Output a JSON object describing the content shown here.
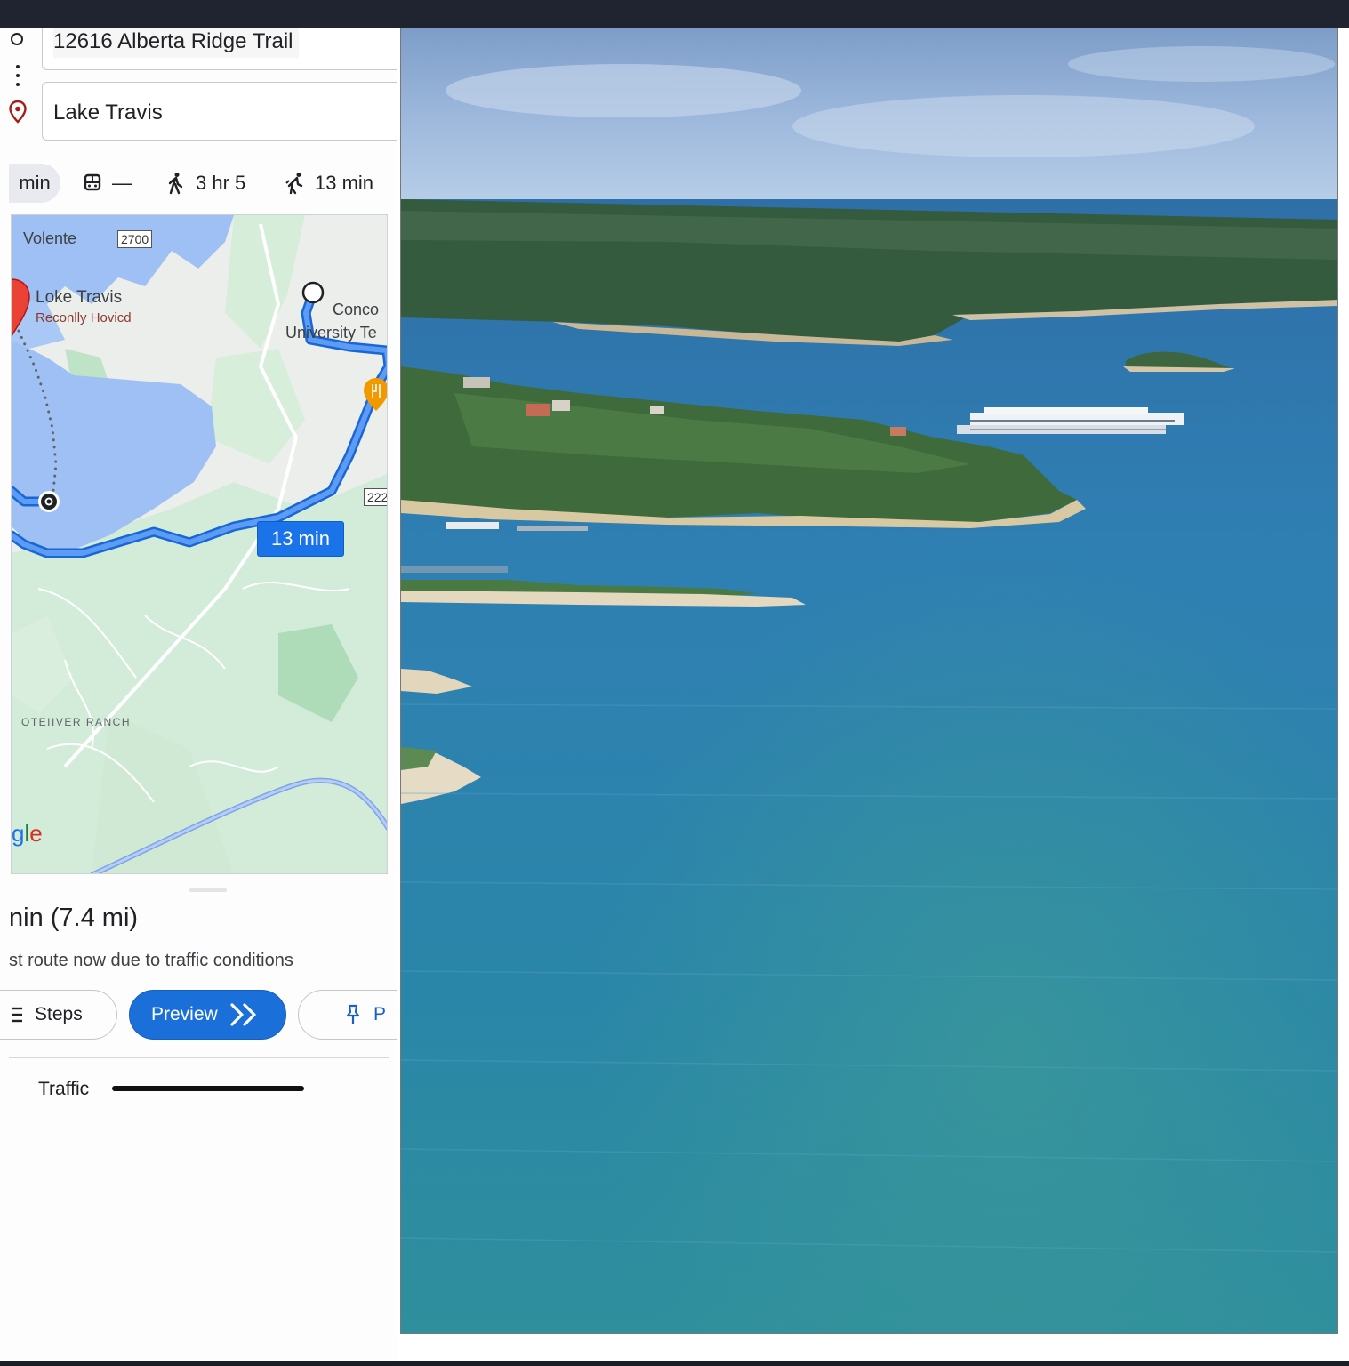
{
  "directions": {
    "origin_value": "12616 Alberta Ridge Trail",
    "destination_value": "Lake Travis"
  },
  "travel_modes": {
    "drive": "min",
    "transit": "—",
    "walk": "3 hr 5",
    "bike": "13 min"
  },
  "map": {
    "places": {
      "volente": "Volente",
      "lake_travis": "Loke Travis",
      "recently_viewed": "Reconlly Hovicd",
      "concordia": "Conco",
      "university": "University Te",
      "ranch": "OTEIIVER RANCH"
    },
    "route_badge": "13 min",
    "shields": {
      "a": "2700",
      "b": "222"
    },
    "logo": {
      "part1": "g",
      "part2": "l",
      "part3": "e"
    }
  },
  "route": {
    "duration": "nin (7.4 mi)",
    "note": "st route now due to traffic conditions"
  },
  "actions": {
    "steps": "Steps",
    "preview": "Preview",
    "pin": "P"
  },
  "traffic": {
    "label": "Traffic"
  },
  "colors": {
    "accent": "#1a73e8",
    "route": "#4285f4",
    "water": "#9fc0f5",
    "park": "#cdebd6"
  }
}
